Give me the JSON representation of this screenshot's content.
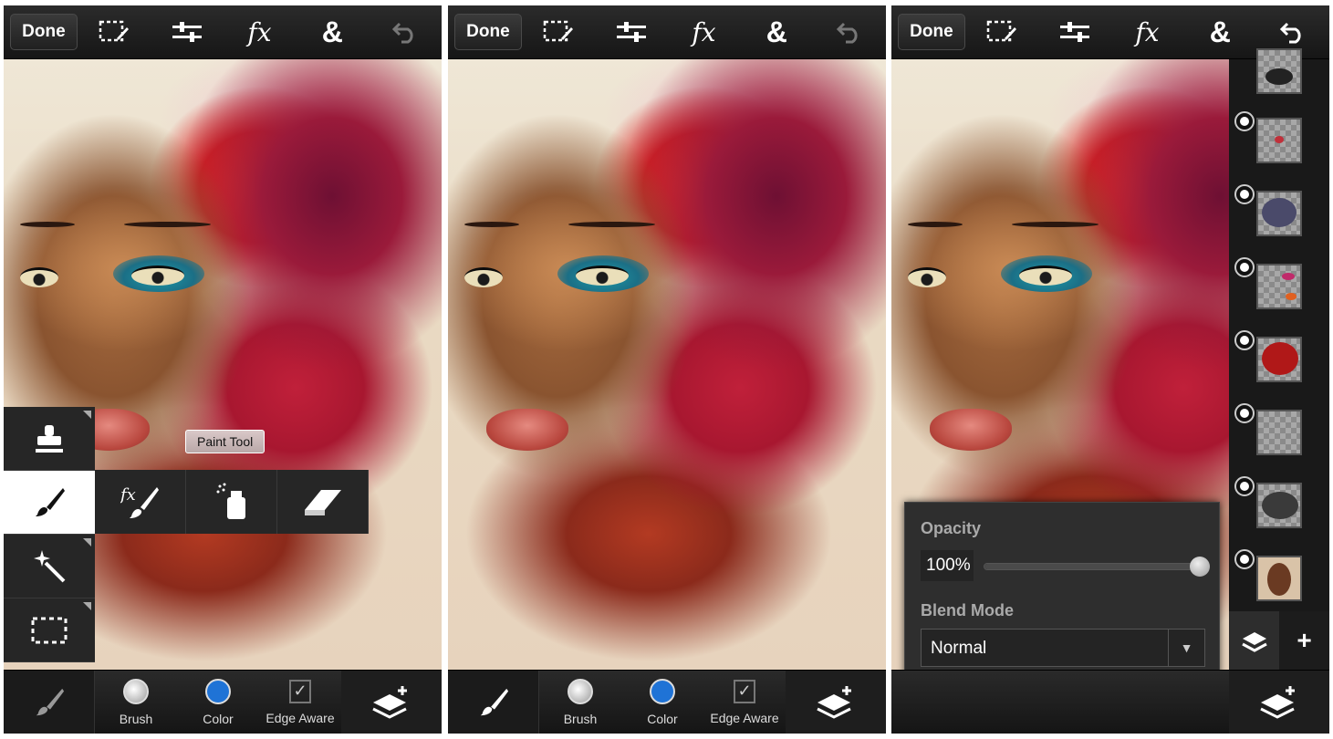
{
  "toolbar": {
    "done_label": "Done",
    "fx_label": "fx",
    "amp_label": "&"
  },
  "panel1": {
    "tooltip": "Paint Tool"
  },
  "bottom": {
    "brush_label": "Brush",
    "color_label": "Color",
    "edge_label": "Edge Aware",
    "color_value": "#1f73d6"
  },
  "layer_popover": {
    "opacity_label": "Opacity",
    "opacity_value": "100%",
    "opacity_level": 1.0,
    "blend_label": "Blend Mode",
    "blend_value": "Normal"
  },
  "icons": [
    "selection-edit-icon",
    "adjustments-icon",
    "fx-icon",
    "ampersand-icon",
    "undo-icon",
    "stamp-icon",
    "brush-icon",
    "magic-wand-icon",
    "marquee-icon",
    "fx-brush-icon",
    "spray-can-icon",
    "eraser-icon",
    "layers-add-icon",
    "merge-down-icon",
    "trash-icon",
    "plus-icon"
  ]
}
